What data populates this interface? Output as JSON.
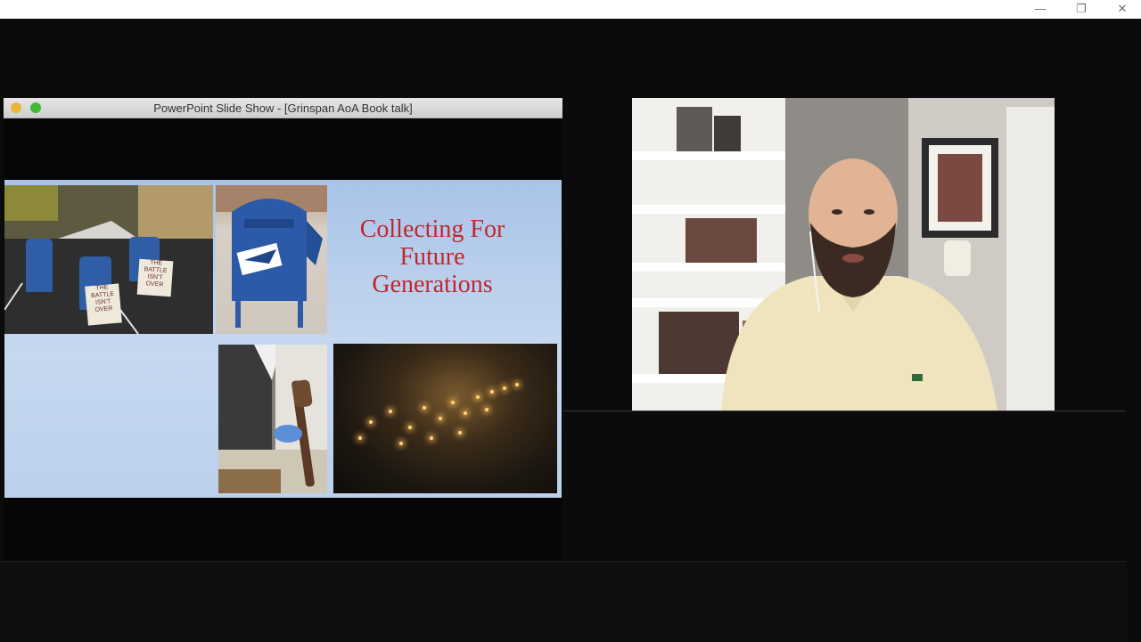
{
  "window_controls": {
    "minimize": "—",
    "restore": "❐",
    "close": "✕"
  },
  "shared_window": {
    "title": "PowerPoint Slide Show - [Grinspan AoA Book talk]"
  },
  "slide": {
    "title_lines": [
      "Collecting For",
      "Future",
      "Generations"
    ],
    "mailbox_sign_text": [
      "THE BATTLE ISN'T OVER",
      "THE BATTLE ISN'T OVER"
    ],
    "title_color": "#c0272d",
    "background_color": "#a9c4e8"
  },
  "video": {
    "participant": "speaker-video"
  }
}
